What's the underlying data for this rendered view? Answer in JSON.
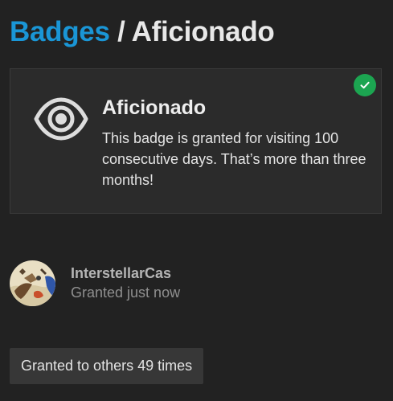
{
  "breadcrumb": {
    "parent": "Badges",
    "separator": "/",
    "current": "Aficionado"
  },
  "badge": {
    "icon": "eye-icon",
    "title": "Aficionado",
    "description": "This badge is granted for visiting 100 consecutive days. That’s more than three months!",
    "status_icon": "check-circle-icon",
    "status_color": "#1ca551"
  },
  "grant": {
    "username": "InterstellarCas",
    "granted": "Granted just now"
  },
  "others": {
    "label": "Granted to others 49 times"
  },
  "colors": {
    "accent": "#1a96d6",
    "background": "#222222",
    "card": "#2b2b2b"
  }
}
